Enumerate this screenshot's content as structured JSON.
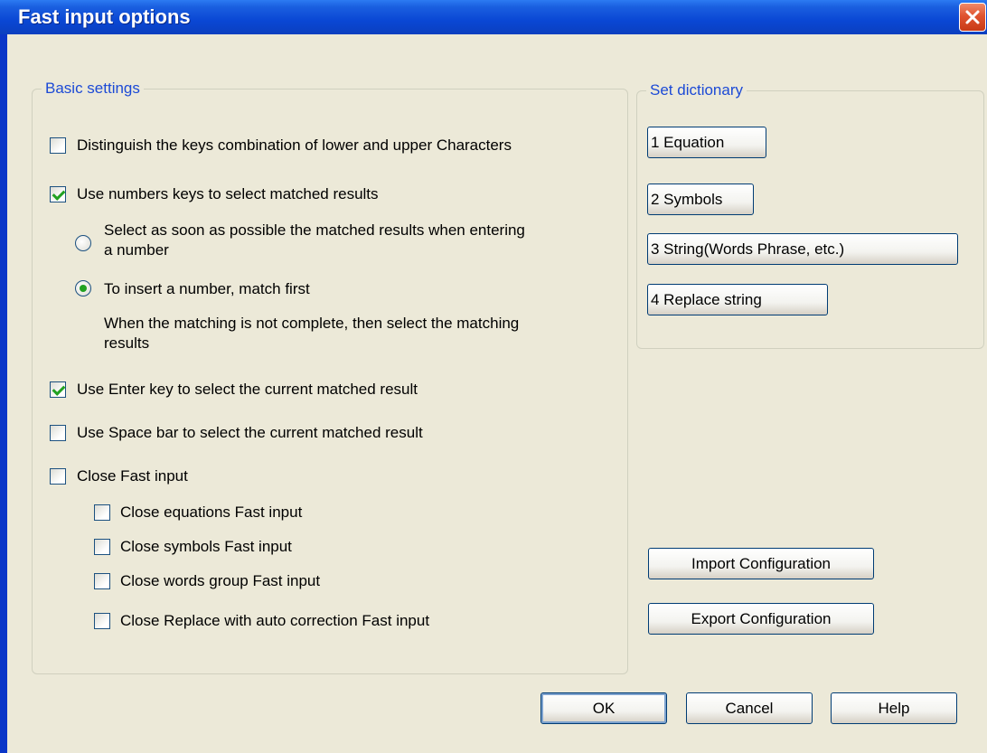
{
  "window": {
    "title": "Fast input options"
  },
  "basic_settings": {
    "legend": "Basic settings",
    "distinguish_case": {
      "label": "Distinguish the keys combination of lower and upper Characters",
      "checked": false
    },
    "use_number_keys": {
      "label": "Use numbers keys to select matched results",
      "checked": true
    },
    "radio_select_asap": {
      "label_line1": "Select as soon as possible the matched results when entering",
      "label_line2": "a number",
      "selected": false
    },
    "radio_insert_number": {
      "label": "To insert a number, match first",
      "selected": true
    },
    "note_line1": "When the matching is not complete, then select the matching",
    "note_line2": "results",
    "use_enter_key": {
      "label": "Use Enter key to select the current matched result",
      "checked": true
    },
    "use_space_bar": {
      "label": "Use Space bar to select the current matched result",
      "checked": false
    },
    "close_fast_input": {
      "label": "Close Fast input",
      "checked": false
    },
    "close_equations": {
      "label": "Close equations Fast input",
      "checked": false
    },
    "close_symbols": {
      "label": "Close symbols Fast input",
      "checked": false
    },
    "close_words_group": {
      "label": "Close words group Fast input",
      "checked": false
    },
    "close_replace": {
      "label": "Close Replace with auto correction Fast input",
      "checked": false
    }
  },
  "set_dictionary": {
    "legend": "Set dictionary",
    "equation_button": "1 Equation",
    "symbols_button": "2 Symbols",
    "string_button": "3 String(Words Phrase, etc.)",
    "replace_button": "4 Replace string"
  },
  "configuration": {
    "import_button": "Import Configuration",
    "export_button": "Export Configuration"
  },
  "footer": {
    "ok_button": "OK",
    "cancel_button": "Cancel",
    "help_button": "Help"
  }
}
